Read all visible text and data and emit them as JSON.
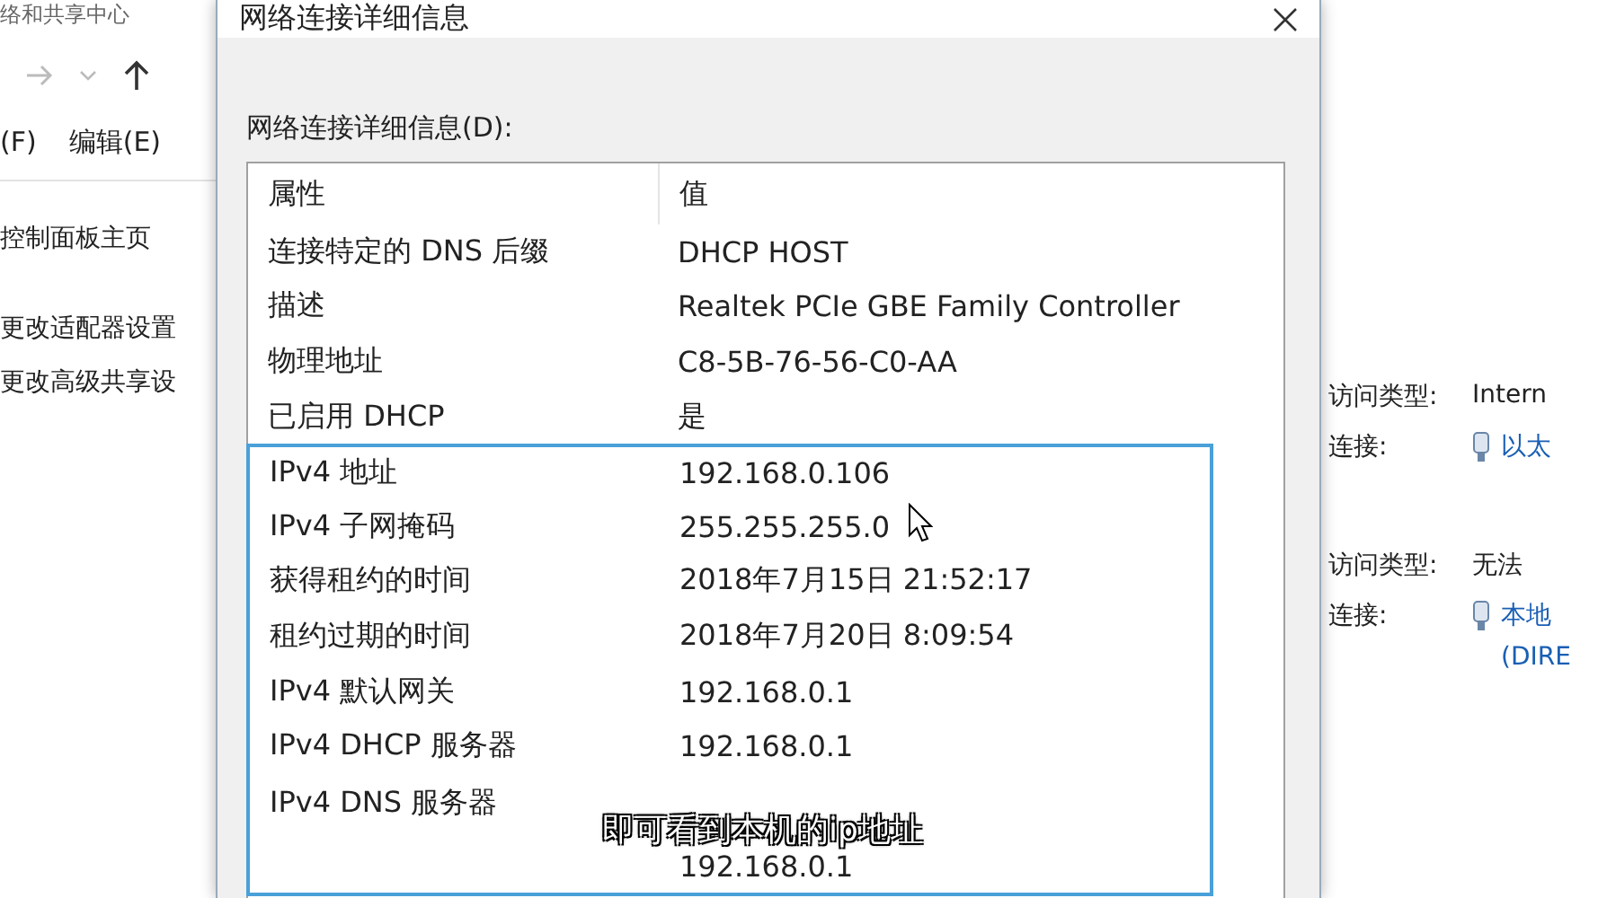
{
  "left_window": {
    "title": "络和共享中心",
    "menu": [
      "(F)",
      "编辑(E)"
    ],
    "links": [
      "控制面板主页",
      "更改适配器设置",
      "更改高级共享设"
    ]
  },
  "dialog": {
    "title": "网络连接详细信息",
    "list_label": "网络连接详细信息(D):",
    "columns": [
      "属性",
      "值"
    ],
    "rows": [
      {
        "property": "连接特定的 DNS 后缀",
        "value": "DHCP HOST",
        "highlighted": false,
        "kind": "single"
      },
      {
        "property": "描述",
        "value": "Realtek PCIe GBE Family Controller",
        "highlighted": false,
        "kind": "single"
      },
      {
        "property": "物理地址",
        "value": "C8-5B-76-56-C0-AA",
        "highlighted": false,
        "kind": "single"
      },
      {
        "property": "已启用 DHCP",
        "value": "是",
        "highlighted": false,
        "kind": "single"
      },
      {
        "property": "IPv4 地址",
        "value": "192.168.0.106",
        "highlighted": true,
        "kind": "single"
      },
      {
        "property": "IPv4 子网掩码",
        "value": "255.255.255.0",
        "highlighted": true,
        "kind": "single"
      },
      {
        "property": "获得租约的时间",
        "value": "2018年7月15日 21:52:17",
        "highlighted": true,
        "kind": "single"
      },
      {
        "property": "租约过期的时间",
        "value": "2018年7月20日 8:09:54",
        "highlighted": true,
        "kind": "single"
      },
      {
        "property": "IPv4 默认网关",
        "value": "192.168.0.1",
        "highlighted": true,
        "kind": "single"
      },
      {
        "property": "IPv4 DHCP 服务器",
        "value": "192.168.0.1",
        "highlighted": true,
        "kind": "single"
      },
      {
        "property": "IPv4 DNS 服务器",
        "value": "192.168.0.1",
        "highlighted": true,
        "kind": "below"
      }
    ]
  },
  "right_window": {
    "networks": [
      {
        "access_label": "访问类型:",
        "access": "Intern",
        "connection_label": "连接:",
        "connection": [
          "以太"
        ]
      },
      {
        "access_label": "访问类型:",
        "access": "无法",
        "connection_label": "连接:",
        "connection": [
          "本地",
          "(DIRE"
        ]
      }
    ]
  },
  "caption": "即可看到本机的ip地址"
}
